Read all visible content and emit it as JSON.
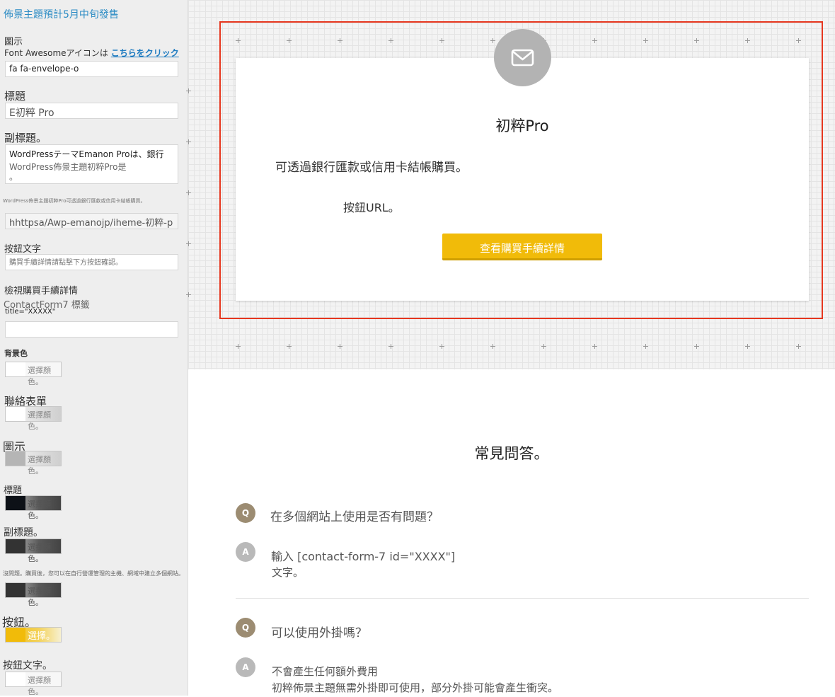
{
  "sidebar": {
    "notice": "佈景主題預計5月中旬發售",
    "icon_section": {
      "label": "圖示",
      "hint": "Font Awesomeアイコンは",
      "hint_link": "こちらをクリック",
      "value": "fa fa-envelope-o"
    },
    "title_section": {
      "label": "標題",
      "value": "E初粹 Pro"
    },
    "subtitle_section": {
      "label": "副標題。",
      "line1": "WordPressテーマEmanon Proは、銀行",
      "line2": "WordPress佈景主題初粹Pro是",
      "line3": "。"
    },
    "small_note": "WordPress佈景主題初粹Pro可透過銀行匯款或信用卡結帳購買。",
    "url_value": "hhttpsa/Awp-emanojp/iheme-初粹-p",
    "button_text_section": {
      "label": "按鈕文字",
      "placeholder": "購買手續詳情請點擊下方按鈕確認。"
    },
    "view_details": "檢視購買手續詳情",
    "contactform": {
      "label": "ContactForm7 標籤",
      "title_hint": "title=\"XXXXX\""
    },
    "colors": {
      "pick_label": "選擇顏色。",
      "pick_short": "選擇。",
      "bg_label": "背景色",
      "contact_label": "聯絡表單",
      "icon_label": "圖示",
      "title_label": "標題",
      "subtitle_label": "副標題。",
      "faq_note": "沒問題。購買後，您可以在自行營運管理的主機、網域中建立多個網站。",
      "button_label": "按鈕。",
      "button_text_label": "按鈕文字。",
      "chip_white": "#ffffff",
      "chip_gray": "#b5b5b5",
      "chip_black": "#0d1117",
      "chip_dark": "#333333",
      "chip_yellow": "#f1bb09"
    }
  },
  "preview": {
    "card_title": "初粹Pro",
    "card_subtitle": "可透過銀行匯款或信用卡結帳購買。",
    "card_url_label": "按鈕URL。",
    "cta_label": "查看購買手續詳情",
    "icon": "envelope-icon",
    "accent": "#f1bb09",
    "highlight": "#e6371f"
  },
  "faq": {
    "title": "常見問答。",
    "q_badge": "Q",
    "a_badge": "A",
    "items": [
      {
        "q": "在多個網站上使用是否有問題？",
        "a_line1": "輸入 [contact-form-7 id=\"XXXX\"]",
        "a_line2": "文字。"
      },
      {
        "q": "可以使用外掛嗎？",
        "a_line1": "不會產生任何額外費用",
        "a_line2": "初粹佈景主題無需外掛即可使用，部分外掛可能會產生衝突。"
      }
    ]
  }
}
